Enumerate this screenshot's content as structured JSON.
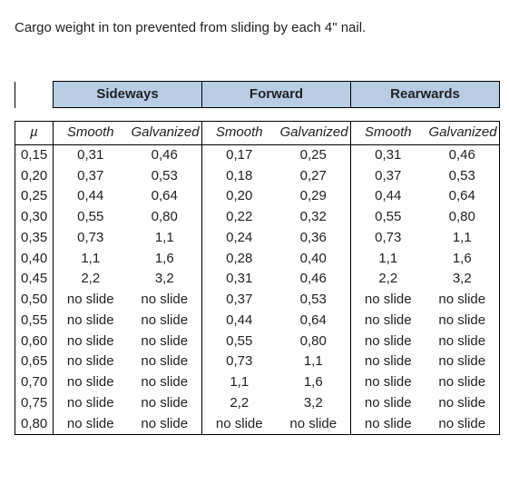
{
  "description": "Cargo weight in ton prevented from sliding by each 4\" nail.",
  "headers": {
    "mu": "µ",
    "groups": [
      "Sideways",
      "Forward",
      "Rearwards"
    ],
    "sub": [
      "Smooth",
      "Galvanized"
    ]
  },
  "rows": [
    {
      "mu": "0,15",
      "v": [
        "0,31",
        "0,46",
        "0,17",
        "0,25",
        "0,31",
        "0,46"
      ]
    },
    {
      "mu": "0,20",
      "v": [
        "0,37",
        "0,53",
        "0,18",
        "0,27",
        "0,37",
        "0,53"
      ]
    },
    {
      "mu": "0,25",
      "v": [
        "0,44",
        "0,64",
        "0,20",
        "0,29",
        "0,44",
        "0,64"
      ]
    },
    {
      "mu": "0,30",
      "v": [
        "0,55",
        "0,80",
        "0,22",
        "0,32",
        "0,55",
        "0,80"
      ]
    },
    {
      "mu": "0,35",
      "v": [
        "0,73",
        "1,1",
        "0,24",
        "0,36",
        "0,73",
        "1,1"
      ]
    },
    {
      "mu": "0,40",
      "v": [
        "1,1",
        "1,6",
        "0,28",
        "0,40",
        "1,1",
        "1,6"
      ]
    },
    {
      "mu": "0,45",
      "v": [
        "2,2",
        "3,2",
        "0,31",
        "0,46",
        "2,2",
        "3,2"
      ]
    },
    {
      "mu": "0,50",
      "v": [
        "no slide",
        "no slide",
        "0,37",
        "0,53",
        "no slide",
        "no slide"
      ]
    },
    {
      "mu": "0,55",
      "v": [
        "no slide",
        "no slide",
        "0,44",
        "0,64",
        "no slide",
        "no slide"
      ]
    },
    {
      "mu": "0,60",
      "v": [
        "no slide",
        "no slide",
        "0,55",
        "0,80",
        "no slide",
        "no slide"
      ]
    },
    {
      "mu": "0,65",
      "v": [
        "no slide",
        "no slide",
        "0,73",
        "1,1",
        "no slide",
        "no slide"
      ]
    },
    {
      "mu": "0,70",
      "v": [
        "no slide",
        "no slide",
        "1,1",
        "1,6",
        "no slide",
        "no slide"
      ]
    },
    {
      "mu": "0,75",
      "v": [
        "no slide",
        "no slide",
        "2,2",
        "3,2",
        "no slide",
        "no slide"
      ]
    },
    {
      "mu": "0,80",
      "v": [
        "no slide",
        "no slide",
        "no slide",
        "no slide",
        "no slide",
        "no slide"
      ]
    }
  ],
  "chart_data": {
    "type": "table",
    "title": "Cargo weight in ton prevented from sliding by each 4\" nail.",
    "columns": [
      "µ",
      "Sideways Smooth",
      "Sideways Galvanized",
      "Forward Smooth",
      "Forward Galvanized",
      "Rearwards Smooth",
      "Rearwards Galvanized"
    ]
  }
}
